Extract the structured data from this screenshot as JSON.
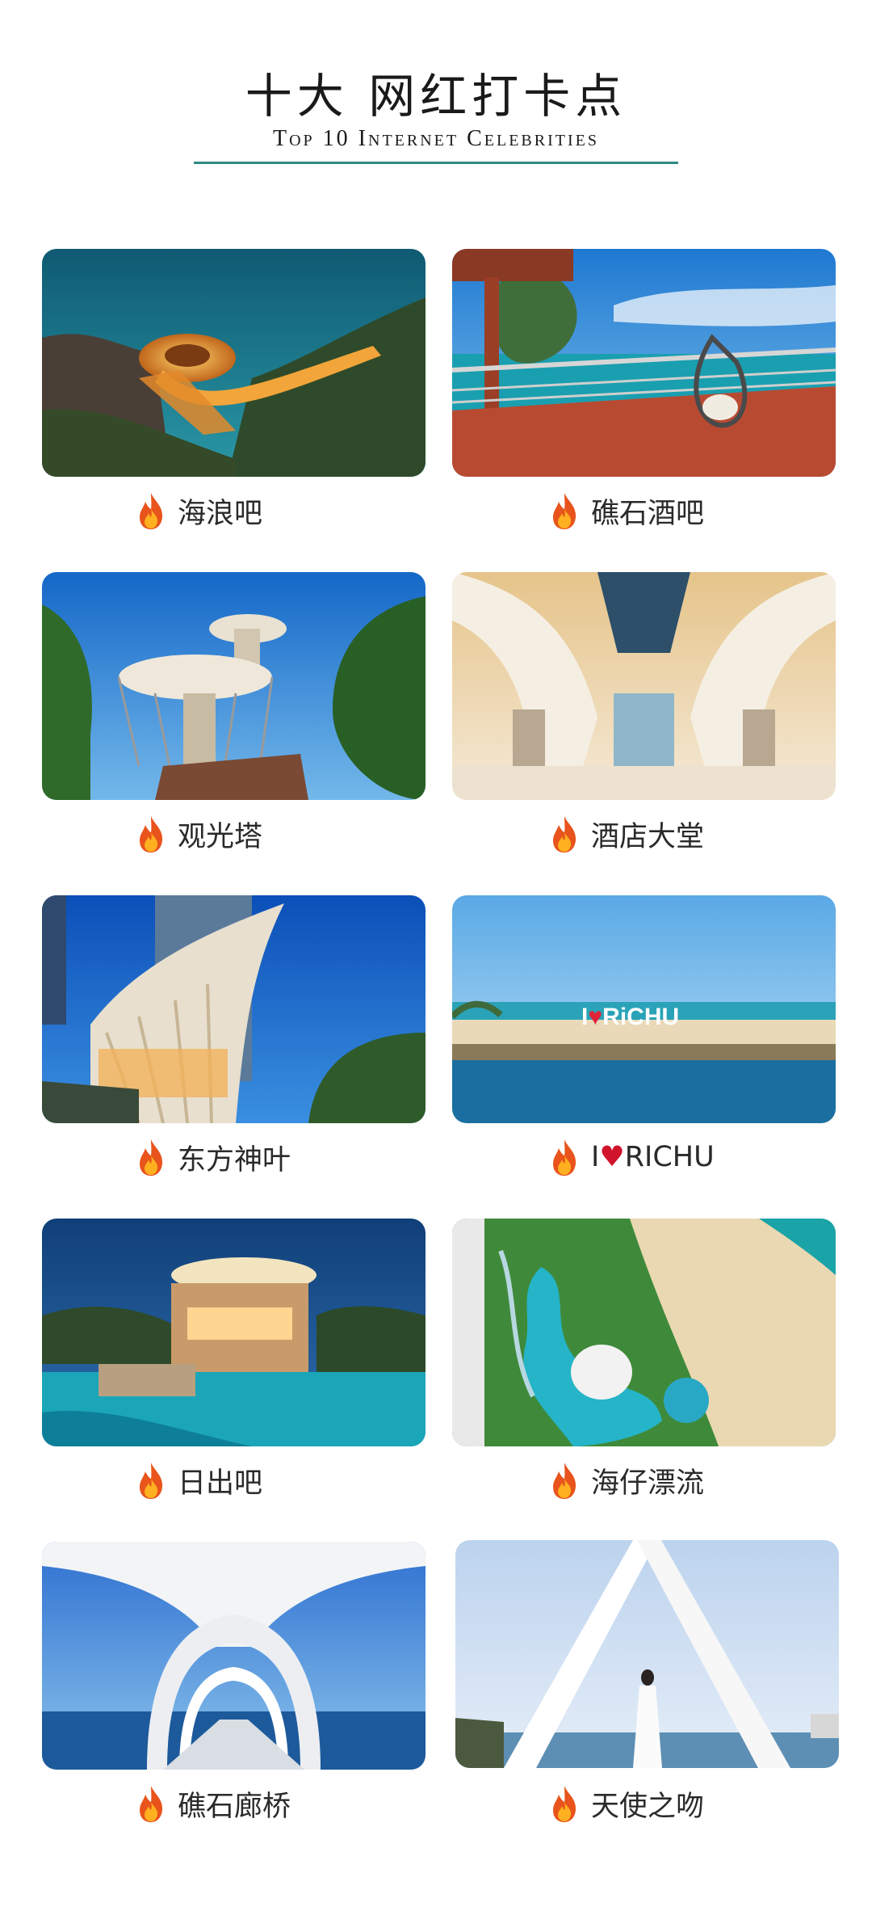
{
  "header": {
    "title": "十大 网红打卡点",
    "subtitle": "Top 10 Internet Celebrities"
  },
  "spots": [
    {
      "name": "海浪吧",
      "icon": "fire-icon"
    },
    {
      "name": "礁石酒吧",
      "icon": "fire-icon"
    },
    {
      "name": "观光塔",
      "icon": "fire-icon"
    },
    {
      "name": "酒店大堂",
      "icon": "fire-icon"
    },
    {
      "name": "东方神叶",
      "icon": "fire-icon"
    },
    {
      "name_prefix": "I",
      "name_heart": "♥",
      "name_suffix": "RICHU",
      "icon": "fire-icon"
    },
    {
      "name": "日出吧",
      "icon": "fire-icon"
    },
    {
      "name": "海仔漂流",
      "icon": "fire-icon"
    },
    {
      "name": "礁石廊桥",
      "icon": "fire-icon"
    },
    {
      "name": "天使之吻",
      "icon": "fire-icon"
    }
  ],
  "photo_signs": {
    "beach_sign_prefix": "I",
    "beach_sign_suffix": "RiCHU"
  },
  "colors": {
    "accent_rule": "#2f8a7f",
    "heart": "#d0142c",
    "flame_outer": "#e8541c",
    "flame_inner": "#ffb020"
  }
}
